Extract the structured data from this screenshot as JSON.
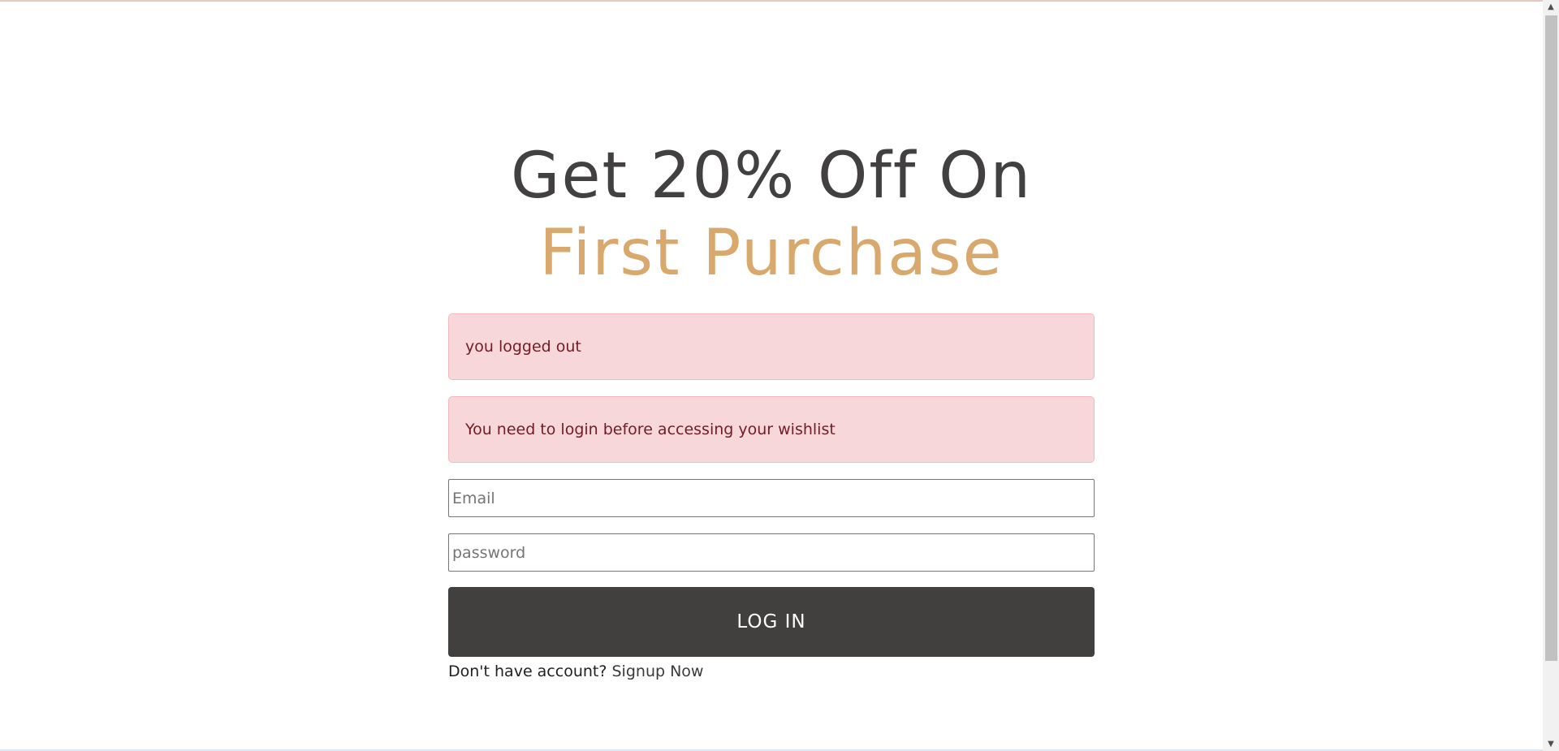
{
  "hero": {
    "line1": "Get 20% Off On",
    "line2": "First Purchase"
  },
  "alerts": [
    {
      "text": "you logged out"
    },
    {
      "text": "You need to login before accessing your wishlist"
    }
  ],
  "form": {
    "email_placeholder": "Email",
    "password_placeholder": "password",
    "login_label": "LOG IN",
    "signup_prompt": "Don't have account?",
    "signup_link": "Signup Now"
  },
  "scrollbar": {
    "up_icon": "chevron-up-icon",
    "down_icon": "chevron-down-icon"
  },
  "colors": {
    "heading_dark": "#424040",
    "heading_accent": "#d9a86c",
    "alert_bg": "#f8d7da",
    "button_bg": "#42403e"
  }
}
